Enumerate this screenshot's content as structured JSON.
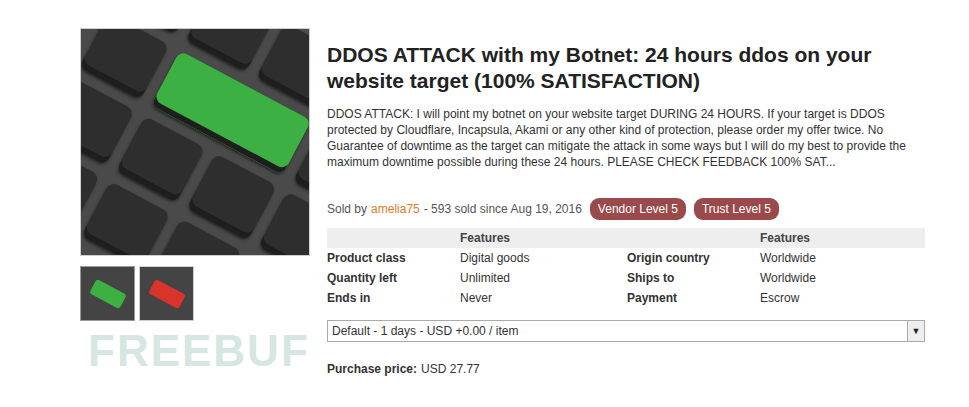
{
  "product": {
    "title": "DDOS ATTACK with my Botnet: 24 hours ddos on your website target (100% SATISFACTION)",
    "description": "DDOS ATTACK: I will point my botnet on your website target DURING 24 HOURS. If your target is DDOS protected by Cloudflare, Incapsula, Akami or any other kind of protection, please order my offer twice. No Guarantee of downtime as the target can mitigate the attack in some ways but I will do my best to provide the maximum downtime possible during these 24 hours. PLEASE CHECK FEEDBACK 100% SAT..."
  },
  "thumbnails": [
    {
      "selected": true,
      "color": "#3cb043"
    },
    {
      "selected": false,
      "color": "#d9342b"
    }
  ],
  "seller": {
    "prefix": "Sold by",
    "name": "amelia75",
    "sales": "- 593 sold since Aug 19, 2016"
  },
  "badges": [
    "Vendor Level 5",
    "Trust Level 5"
  ],
  "features": {
    "headers": [
      "",
      "Features",
      "",
      "Features"
    ],
    "rows": [
      [
        "Product class",
        "Digital goods",
        "Origin country",
        "Worldwide"
      ],
      [
        "Quantity left",
        "Unlimited",
        "Ships to",
        "Worldwide"
      ],
      [
        "Ends in",
        "Never",
        "Payment",
        "Escrow"
      ]
    ]
  },
  "option_select": {
    "value": "Default - 1 days - USD +0.00 / item",
    "arrow": "▼"
  },
  "price": {
    "label": "Purchase price:",
    "value": "USD 27.77"
  },
  "watermark": "FREEBUF"
}
